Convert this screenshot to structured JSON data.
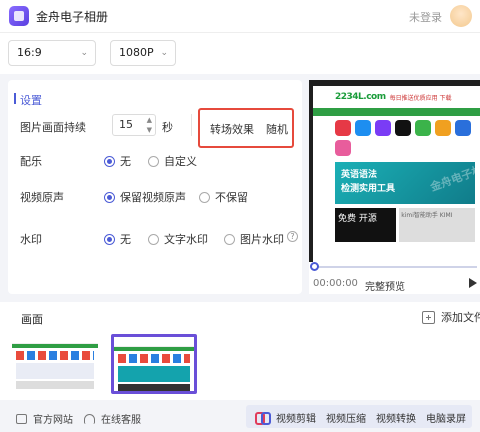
{
  "app": {
    "title": "金舟电子相册",
    "login_status": "未登录"
  },
  "toolbar": {
    "aspect_ratio": "16:9",
    "resolution": "1080P"
  },
  "settings": {
    "title": "设置",
    "duration_label": "图片画面持续",
    "duration_value": "15",
    "duration_unit": "秒",
    "transition_label": "转场效果",
    "transition_value": "随机",
    "music_label": "配乐",
    "music_options": [
      "无",
      "自定义"
    ],
    "music_selected": "无",
    "original_sound_label": "视频原声",
    "original_sound_options": [
      "保留视频原声",
      "不保留"
    ],
    "original_sound_selected": "保留视频原声",
    "watermark_label": "水印",
    "watermark_options": [
      "无",
      "文字水印",
      "图片水印"
    ],
    "watermark_selected": "无",
    "help_symbol": "?"
  },
  "preview": {
    "time": "00:00:00",
    "full_preview_label": "完整预览",
    "site_logo": "2234L.com",
    "site_slogan": "每日推送优质应用 下载",
    "banner_line1": "英语语法",
    "banner_line2": "检测实用工具",
    "banner_watermark": "金舟电子相册",
    "promo_text": "免费 开源",
    "promo_side": "kimi智能助手 KIMI"
  },
  "canvas": {
    "title": "画面",
    "add_file_label": "添加文件"
  },
  "footer": {
    "official_site": "官方网站",
    "online_service": "在线客服",
    "tools": [
      "视频剪辑",
      "视频压缩",
      "视频转换",
      "电脑录屏"
    ]
  },
  "colors": {
    "accent": "#4b5bd6",
    "highlight_border": "#e64a3c",
    "thumb_selected": "#6a4fd8"
  }
}
